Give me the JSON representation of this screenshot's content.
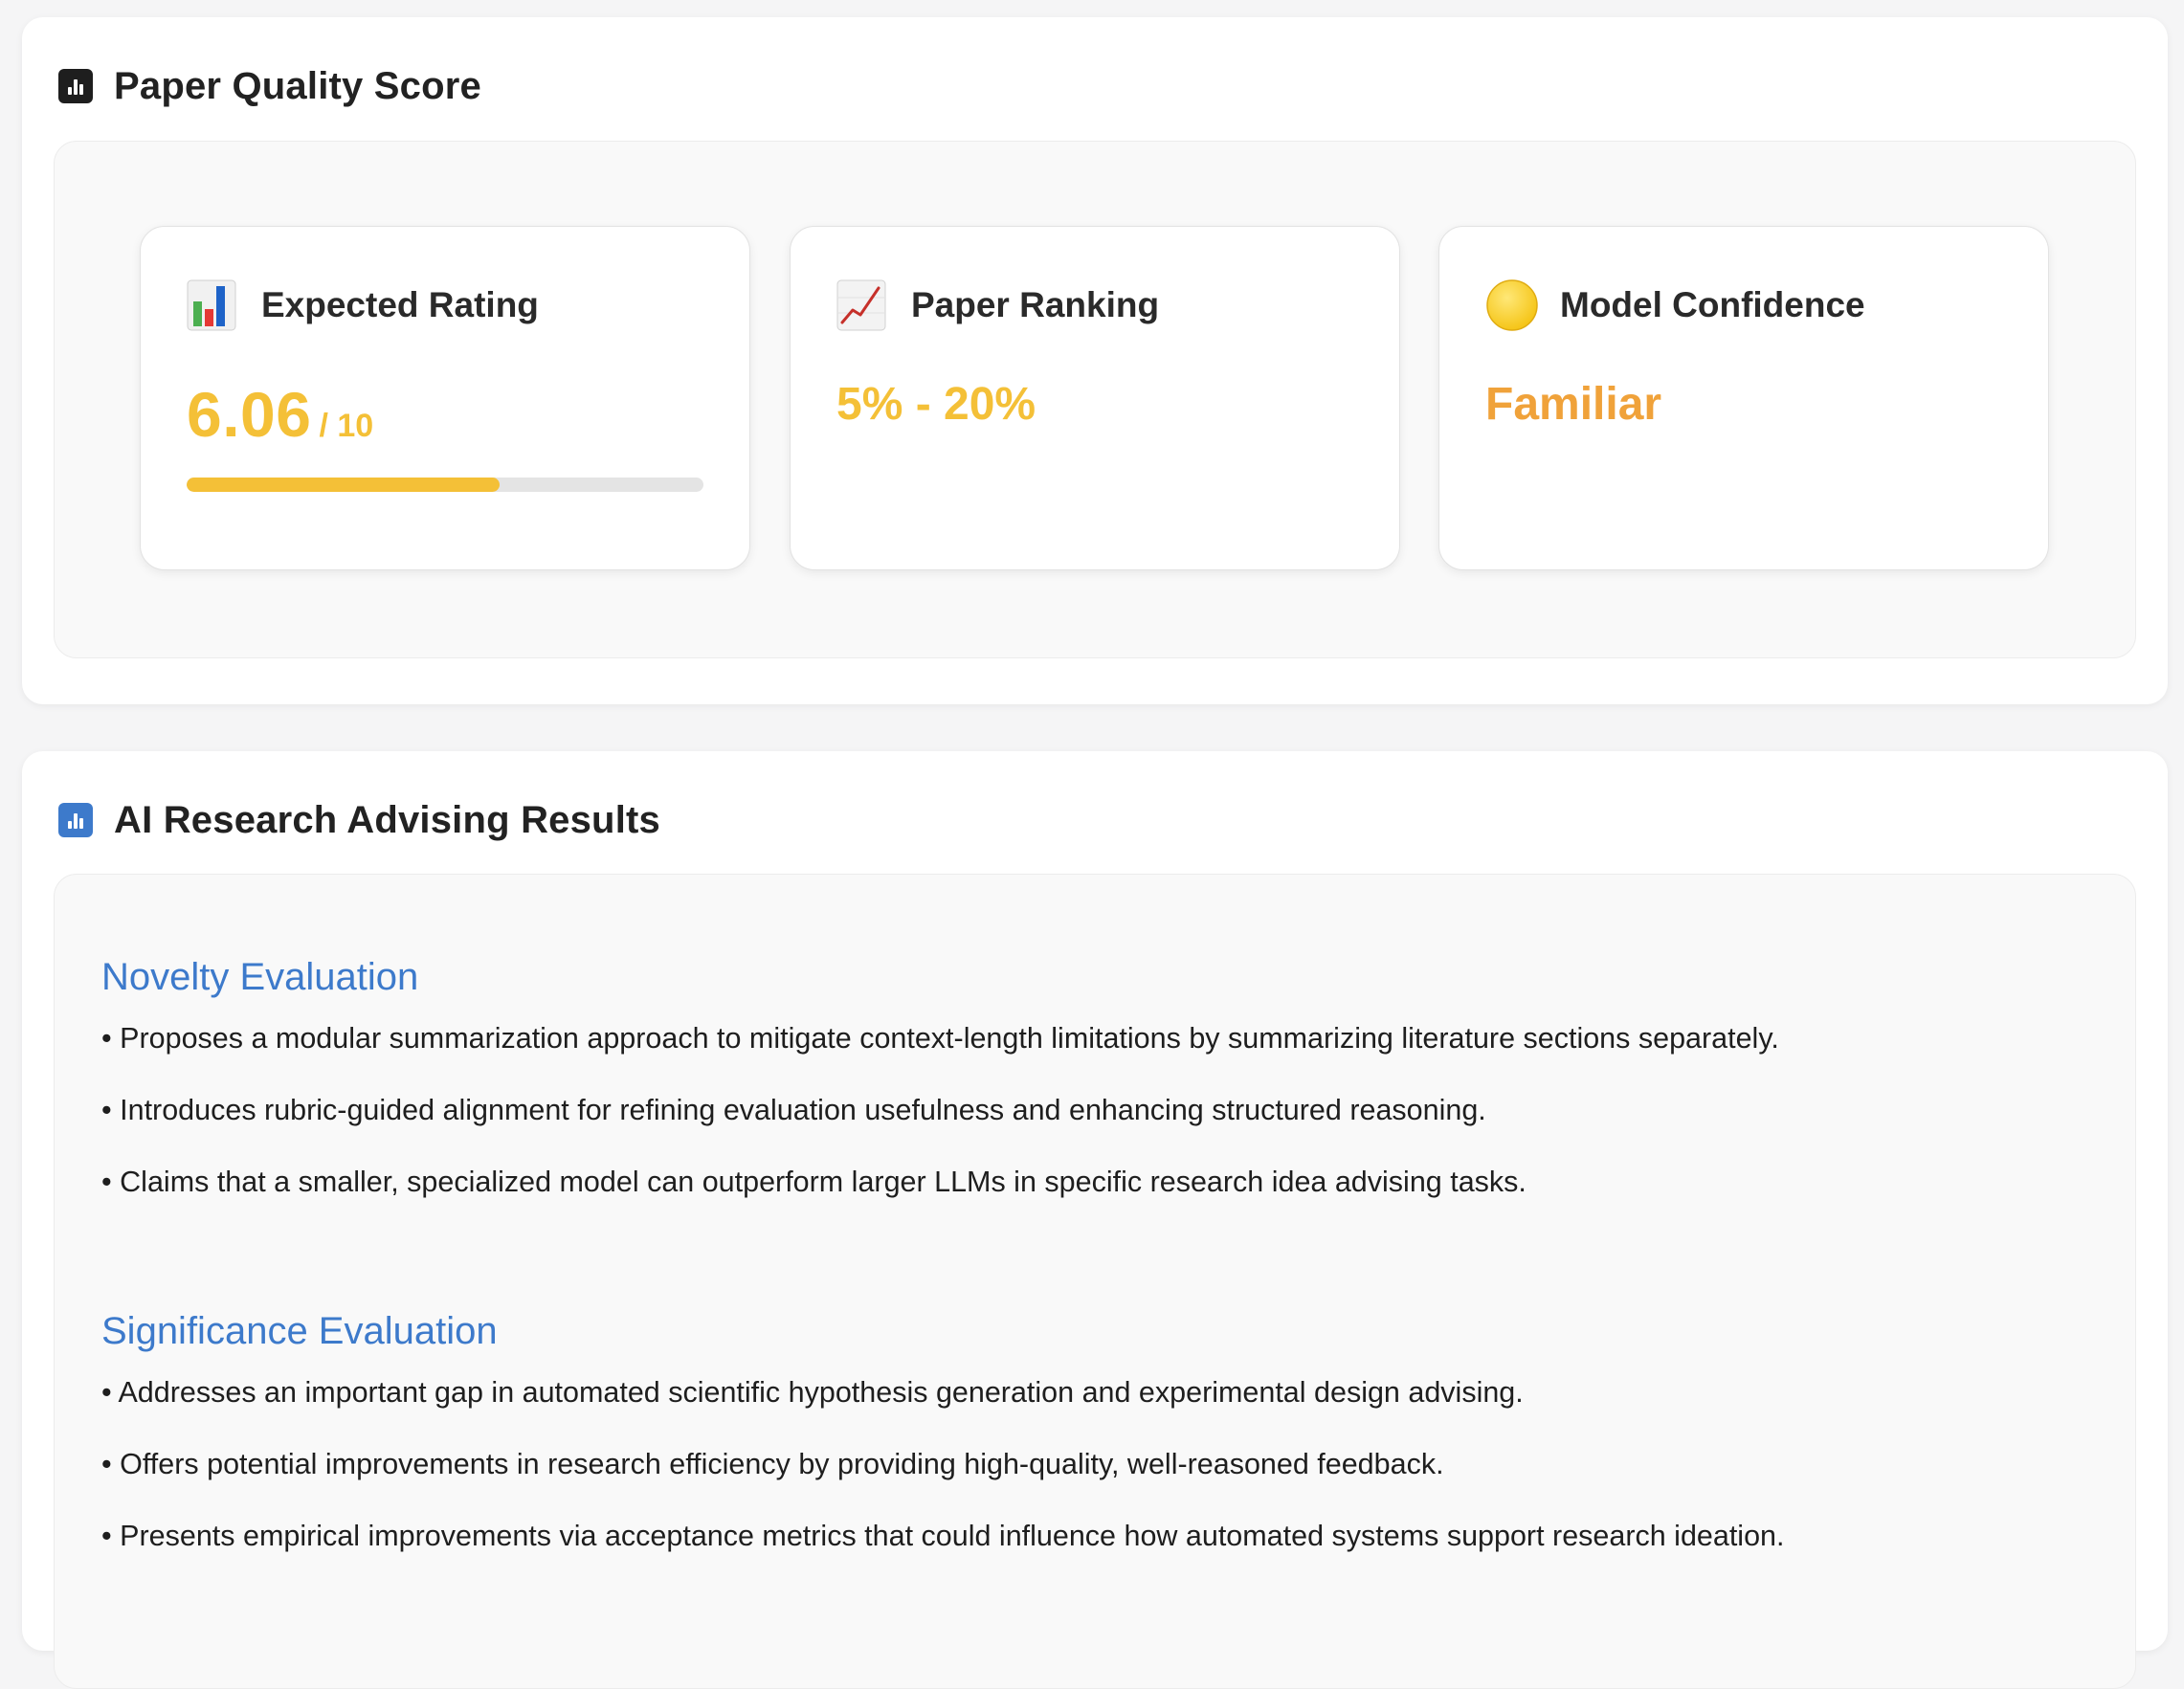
{
  "quality_panel": {
    "title": "Paper Quality Score",
    "icon": "bar-chart-icon",
    "icon_color": "#1e1e1e"
  },
  "metrics": {
    "expected_rating": {
      "label": "Expected Rating",
      "icon": "bar-chart-emoji-icon",
      "value": "6.06",
      "scale": "/ 10",
      "progress_fraction": 0.606,
      "color": "#f4c037"
    },
    "paper_ranking": {
      "label": "Paper Ranking",
      "icon": "trending-up-chart-icon",
      "value": "5% - 20%",
      "color": "#f4c037"
    },
    "model_confidence": {
      "label": "Model Confidence",
      "icon": "yellow-circle-icon",
      "value": "Familiar",
      "color": "#f0a23a"
    }
  },
  "advising_panel": {
    "title": "AI Research Advising Results",
    "icon": "bar-chart-icon",
    "icon_color": "#3d7acb"
  },
  "sections": [
    {
      "title": "Novelty Evaluation",
      "bullets": [
        "• Proposes a modular summarization approach to mitigate context-length limitations by summarizing literature sections separately.",
        "• Introduces rubric-guided alignment for refining evaluation usefulness and enhancing structured reasoning.",
        "• Claims that a smaller, specialized model can outperform larger LLMs in specific research idea advising tasks."
      ]
    },
    {
      "title": "Significance Evaluation",
      "bullets": [
        "• Addresses an important gap in automated scientific hypothesis generation and experimental design advising.",
        "• Offers potential improvements in research efficiency by providing high-quality, well-reasoned feedback.",
        "• Presents empirical improvements via acceptance metrics that could influence how automated systems support research ideation."
      ]
    }
  ],
  "colors": {
    "accent_blue": "#3d7acb",
    "accent_yellow": "#f4c037",
    "accent_orange": "#f0a23a"
  }
}
